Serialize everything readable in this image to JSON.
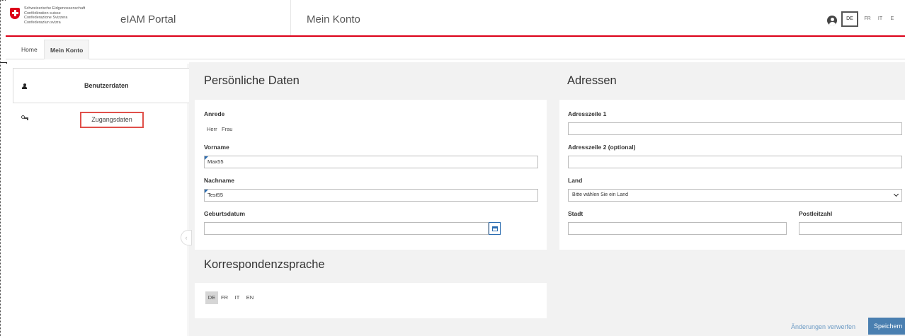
{
  "header": {
    "logo_lines": [
      "Schweizerische Eidgenossenschaft",
      "Confédération suisse",
      "Confederazione Svizzera",
      "Confederaziun svizra"
    ],
    "app_title": "eIAM Portal",
    "page_title": "Mein Konto",
    "languages": [
      "DE",
      "FR",
      "IT",
      "E"
    ],
    "active_language": "DE"
  },
  "breadcrumb": {
    "home": "Home",
    "current": "Mein Konto"
  },
  "sidebar": {
    "items": [
      {
        "label": "Benutzerdaten",
        "icon": "person-icon"
      },
      {
        "label": "Zugangsdaten",
        "icon": "key-icon"
      }
    ]
  },
  "personal": {
    "title": "Persönliche Daten",
    "salutation_label": "Anrede",
    "salutation_options": [
      "Herr",
      "Frau"
    ],
    "firstname_label": "Vorname",
    "firstname_value": "Max55",
    "lastname_label": "Nachname",
    "lastname_value": "Test55",
    "birthdate_label": "Geburtsdatum",
    "birthdate_value": ""
  },
  "addresses": {
    "title": "Adressen",
    "line1_label": "Adresszeile 1",
    "line2_label": "Adresszeile 2 (optional)",
    "country_label": "Land",
    "country_placeholder": "Bitte wählen Sie ein Land",
    "city_label": "Stadt",
    "zip_label": "Postleitzahl"
  },
  "correspondence": {
    "title": "Korrespondenzsprache",
    "options": [
      "DE",
      "FR",
      "IT",
      "EN"
    ],
    "selected": "DE"
  },
  "actions": {
    "discard": "Änderungen verwerfen",
    "save": "Speichern"
  },
  "colors": {
    "brand_red": "#dc0018",
    "accent_blue": "#4a7fb0",
    "highlight_box": "#e0504a"
  }
}
